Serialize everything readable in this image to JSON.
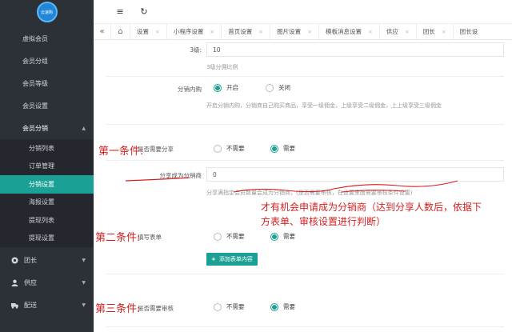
{
  "logo": {
    "text": "云速购"
  },
  "sidebar": {
    "items": [
      {
        "label": "虚拟会员"
      },
      {
        "label": "会员分组"
      },
      {
        "label": "会员等级"
      },
      {
        "label": "会员设置"
      }
    ],
    "parent": {
      "label": "会员分销",
      "caret": "▲"
    },
    "sub_items": [
      {
        "label": "分销列表"
      },
      {
        "label": "订单管理"
      },
      {
        "label": "分销设置",
        "active": true
      },
      {
        "label": "海报设置"
      },
      {
        "label": "提现列表"
      },
      {
        "label": "提现设置"
      }
    ],
    "groups": [
      {
        "label": "团长",
        "icon": "dot-icon",
        "caret": "▼"
      },
      {
        "label": "供应",
        "icon": "person-icon",
        "caret": "▼"
      },
      {
        "label": "配送",
        "icon": "truck-icon",
        "caret": "▼"
      }
    ]
  },
  "topbar": {
    "menu_icon": "≡",
    "refresh_icon": "↻"
  },
  "tabs": {
    "back": "«",
    "home_icon": "⌂",
    "items": [
      {
        "label": "设置"
      },
      {
        "label": "小程序设置"
      },
      {
        "label": "首页设置"
      },
      {
        "label": "图片设置"
      },
      {
        "label": "模板消息设置"
      },
      {
        "label": "供应"
      },
      {
        "label": "团长"
      },
      {
        "label": "团长设"
      }
    ],
    "close": "×"
  },
  "form": {
    "level3": {
      "label": "3级:",
      "value": "10",
      "hint": "3级分佣比例"
    },
    "self_buy": {
      "label": "分销内购",
      "on": "开启",
      "off": "关闭",
      "hint": "开启分销内购，分销商自己购买商品，享受一级佣金，上级享受二级佣金，上上级享受三级佣金"
    },
    "need_share": {
      "label": "是否需要分享",
      "no": "不需要",
      "yes": "需要"
    },
    "share_count": {
      "label": "分享成为分销商",
      "value": "0",
      "hint": "分享满指定会员数量会成为分销商，(是否需要审核，在设置里面需要审核条件设置)"
    },
    "fill_form": {
      "label": "填写表单",
      "no": "不需要",
      "yes": "需要",
      "add_button": "添加表单内容"
    },
    "need_review": {
      "label": "是否需要审核",
      "no": "不需要",
      "yes": "需要"
    }
  },
  "annotations": {
    "cond1": "第一条件:",
    "cond2": "第二条件:",
    "cond3": "第三条件:",
    "note_line1": "才有机会申请成为分销商（达到分享人数后，依据下",
    "note_line2": "方表单、审核设置进行判断）"
  },
  "colors": {
    "accent": "#1aa094",
    "sidebar_bg": "#2c3138",
    "annotation": "#d62020"
  }
}
